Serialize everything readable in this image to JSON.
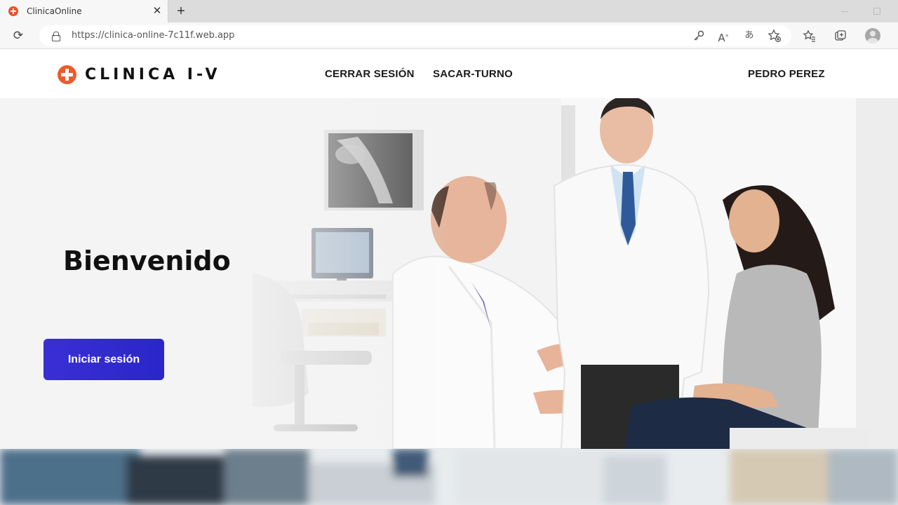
{
  "browser": {
    "tab_title": "ClinicaOnline",
    "tab_close": "✕",
    "new_tab": "+",
    "url": "https://clinica-online-7c11f.web.app"
  },
  "nav": {
    "logo_text": "CLINICA I-V",
    "links": [
      "CERRAR SESIÓN",
      "SACAR-TURNO"
    ],
    "user_name": "PEDRO PEREZ"
  },
  "hero": {
    "title": "Bienvenido",
    "login_button": "Iniciar sesión"
  },
  "colors": {
    "brand_orange": "#ee5a2b",
    "button_blue": "#2f2bd0"
  },
  "icons": [
    "reload-icon",
    "lock-icon",
    "key-icon",
    "read-aloud-icon",
    "translate-icon",
    "favorite-add-icon",
    "favorites-icon",
    "collections-icon",
    "profile-avatar-icon"
  ]
}
